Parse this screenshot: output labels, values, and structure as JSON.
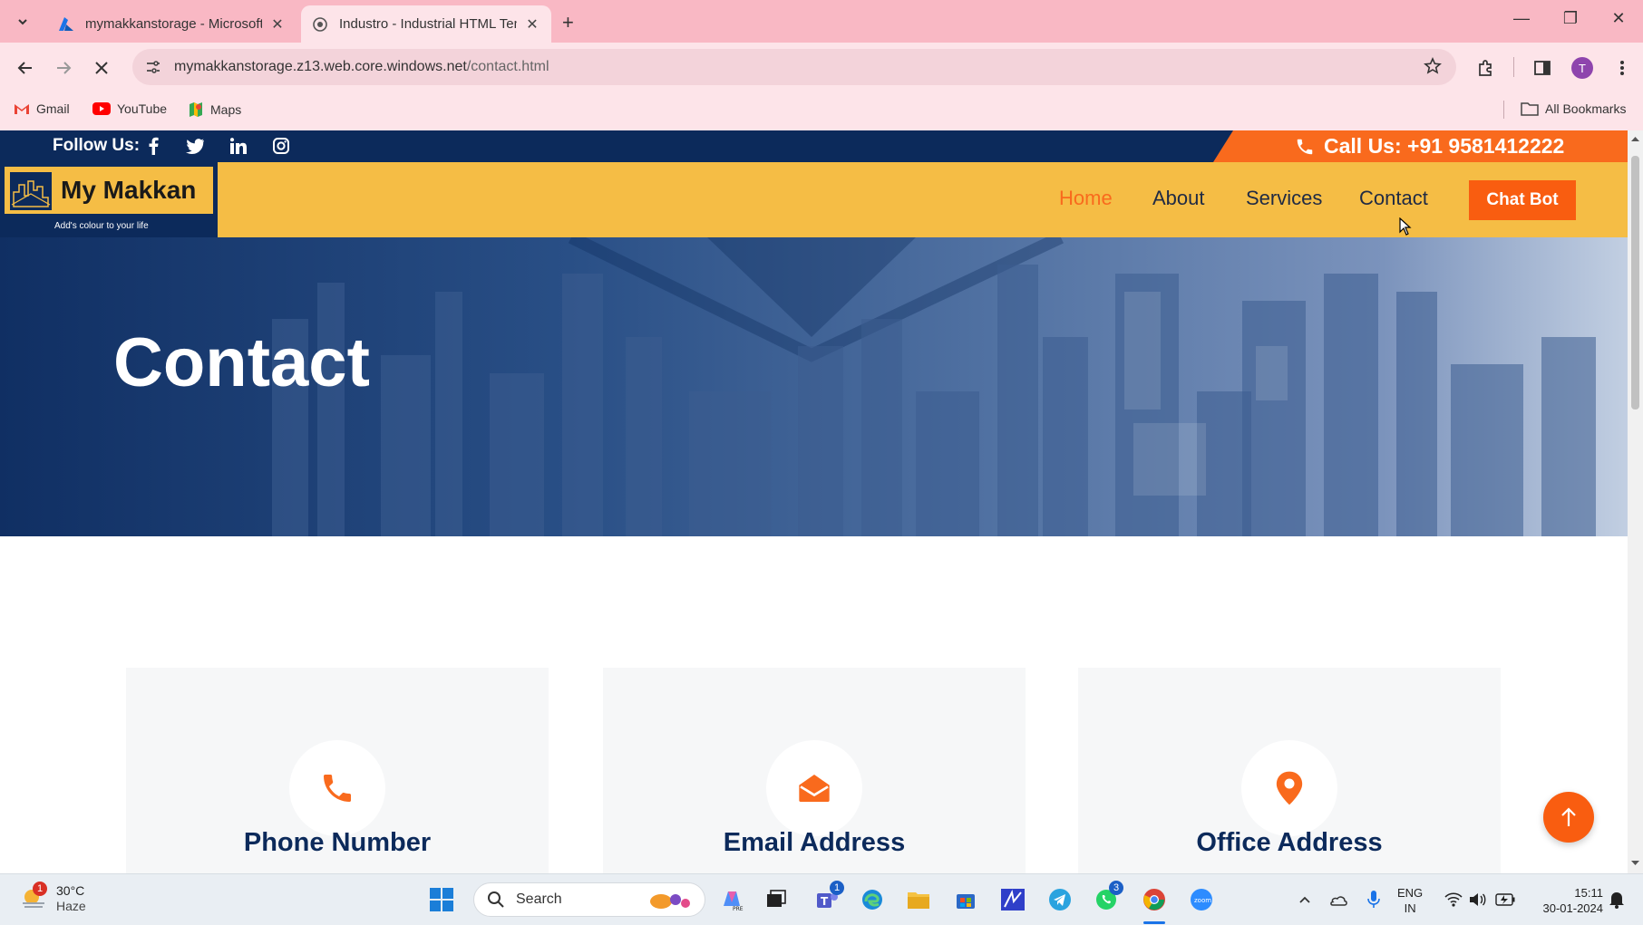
{
  "browser": {
    "tabs": [
      {
        "title": "mymakkanstorage - Microsoft A",
        "active": false
      },
      {
        "title": "Industro - Industrial HTML Tem",
        "active": true
      }
    ],
    "url_host": "mymakkanstorage.z13.web.core.windows.net",
    "url_path": "/contact.html",
    "avatar_letter": "T",
    "bookmarks": [
      "Gmail",
      "YouTube",
      "Maps"
    ],
    "all_bookmarks": "All Bookmarks"
  },
  "site": {
    "follow_label": "Follow Us:",
    "call_label": "Call Us: +91 9581412222",
    "logo_name": "My Makkan",
    "logo_tagline": "Add's colour to your life",
    "menu": [
      "Home",
      "About",
      "Services",
      "Contact"
    ],
    "active_menu": "Home",
    "chatbot_label": "Chat Bot",
    "hero_title": "Contact",
    "cards": [
      {
        "title": "Phone Number",
        "icon": "phone-icon"
      },
      {
        "title": "Email Address",
        "icon": "envelope-open-icon"
      },
      {
        "title": "Office Address",
        "icon": "map-pin-icon"
      }
    ],
    "accent_color": "#f96a1d",
    "navy_color": "#0c2a5b",
    "nav_color": "#f5bd45"
  },
  "taskbar": {
    "weather_temp": "30°C",
    "weather_desc": "Haze",
    "weather_badge": "1",
    "search_placeholder": "Search",
    "teams_badge": "1",
    "whatsapp_badge": "3",
    "lang_line1": "ENG",
    "lang_line2": "IN",
    "time": "15:11",
    "date": "30-01-2024"
  }
}
